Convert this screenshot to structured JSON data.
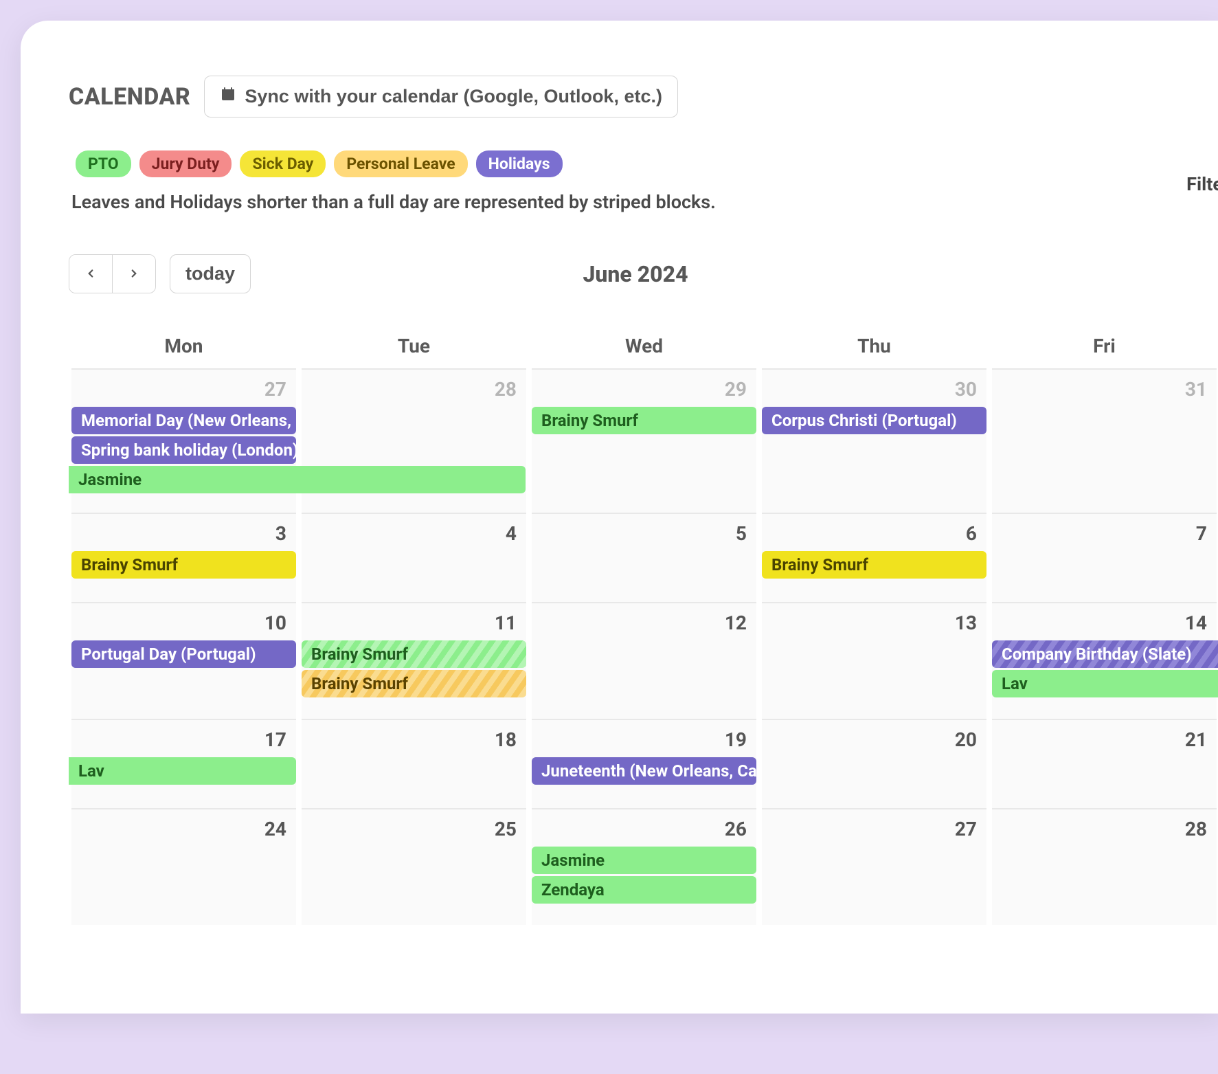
{
  "header": {
    "title": "CALENDAR",
    "sync_label": "Sync with your calendar (Google, Outlook, etc.)"
  },
  "legend": {
    "pto": "PTO",
    "jury": "Jury Duty",
    "sick": "Sick Day",
    "personal": "Personal Leave",
    "holiday": "Holidays"
  },
  "note": "Leaves and Holidays shorter than a full day are represented by striped blocks.",
  "filter_label": "Filte",
  "controls": {
    "today": "today",
    "month_title": "June 2024"
  },
  "day_headers": [
    "Mon",
    "Tue",
    "Wed",
    "Thu",
    "Fri"
  ],
  "weeks": [
    {
      "days": [
        {
          "num": "27",
          "muted": true
        },
        {
          "num": "28",
          "muted": true
        },
        {
          "num": "29",
          "muted": true
        },
        {
          "num": "30",
          "muted": true
        },
        {
          "num": "31",
          "muted": true
        }
      ]
    },
    {
      "days": [
        {
          "num": "3",
          "muted": false
        },
        {
          "num": "4",
          "muted": false
        },
        {
          "num": "5",
          "muted": false
        },
        {
          "num": "6",
          "muted": false
        },
        {
          "num": "7",
          "muted": false
        }
      ]
    },
    {
      "days": [
        {
          "num": "10",
          "muted": false
        },
        {
          "num": "11",
          "muted": false
        },
        {
          "num": "12",
          "muted": false
        },
        {
          "num": "13",
          "muted": false
        },
        {
          "num": "14",
          "muted": false
        }
      ]
    },
    {
      "days": [
        {
          "num": "17",
          "muted": false
        },
        {
          "num": "18",
          "muted": false
        },
        {
          "num": "19",
          "muted": false
        },
        {
          "num": "20",
          "muted": false
        },
        {
          "num": "21",
          "muted": false
        }
      ]
    },
    {
      "days": [
        {
          "num": "24",
          "muted": false
        },
        {
          "num": "25",
          "muted": false
        },
        {
          "num": "26",
          "muted": false
        },
        {
          "num": "27",
          "muted": false
        },
        {
          "num": "28",
          "muted": false
        }
      ]
    }
  ],
  "events": {
    "w0": {
      "memorial": "Memorial Day (New Orleans, C",
      "spring": "Spring bank holiday (London)",
      "jasmine": "Jasmine",
      "brainy_wed": "Brainy Smurf",
      "corpus": "Corpus Christi (Portugal)"
    },
    "w1": {
      "brainy_mon": "Brainy Smurf",
      "brainy_thu": "Brainy Smurf"
    },
    "w2": {
      "portugal": "Portugal Day (Portugal)",
      "brainy_pto": "Brainy Smurf",
      "brainy_pers": "Brainy Smurf",
      "company": "Company Birthday (Slate)",
      "lav": "Lav"
    },
    "w3": {
      "lav": "Lav",
      "juneteenth": "Juneteenth (New Orleans, Can"
    },
    "w4": {
      "jasmine": "Jasmine",
      "zendaya": "Zendaya"
    }
  },
  "colors": {
    "pto": "#8cee8c",
    "jury": "#f48b8b",
    "sick": "#f5e537",
    "personal": "#ffd97a",
    "holiday": "#7b6fd0"
  }
}
